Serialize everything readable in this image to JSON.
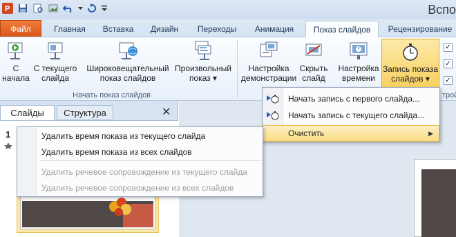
{
  "app": {
    "title": "Вспо"
  },
  "qat": {
    "icons": [
      "powerpoint-logo-icon",
      "save-icon",
      "print-preview-icon",
      "picture-icon",
      "undo-icon",
      "redo-icon",
      "customize-qat-icon"
    ]
  },
  "tabs": [
    {
      "label": "Файл"
    },
    {
      "label": "Главная"
    },
    {
      "label": "Вставка"
    },
    {
      "label": "Дизайн"
    },
    {
      "label": "Переходы"
    },
    {
      "label": "Анимация"
    },
    {
      "label": "Показ слайдов"
    },
    {
      "label": "Рецензирование"
    }
  ],
  "ribbon": {
    "buttons": {
      "from_start": "С\nначала",
      "from_current": "С текущего\nслайда",
      "broadcast": "Широковещательный\nпоказ слайдов",
      "custom": "Произвольный\nпоказ ▾",
      "setup": "Настройка\nдемонстрации",
      "hide": "Скрыть\nслайд",
      "timing": "Настройка\nвремени",
      "record": "Запись показа\nслайдов ▾"
    },
    "group_start_label": "Начать показ слайдов",
    "group_right_label": "тройк"
  },
  "panel": {
    "tab_slides": "Слайды",
    "tab_outline": "Структура",
    "close_glyph": "✕",
    "slide_number": "1"
  },
  "record_menu": {
    "items": [
      {
        "label": "Начать запись с первого слайда..."
      },
      {
        "label": "Начать запись с текущего слайда..."
      },
      {
        "label": "Очистить"
      }
    ]
  },
  "clear_submenu": {
    "items": [
      {
        "label": "Удалить время показа из текущего слайда",
        "enabled": true
      },
      {
        "label": "Удалить время показа из всех слайдов",
        "enabled": true
      },
      {
        "label": "Удалить речевое сопровождение из текущего слайда",
        "enabled": false
      },
      {
        "label": "Удалить речевое сопровождение из всех слайдов",
        "enabled": false
      }
    ]
  },
  "colors": {
    "file_tab": "#d8561c",
    "ribbon_bg": "#e8f0fa",
    "highlight": "#f9dc85",
    "slide_dark": "#4f4846",
    "thumb_accent": "#c75a44"
  }
}
